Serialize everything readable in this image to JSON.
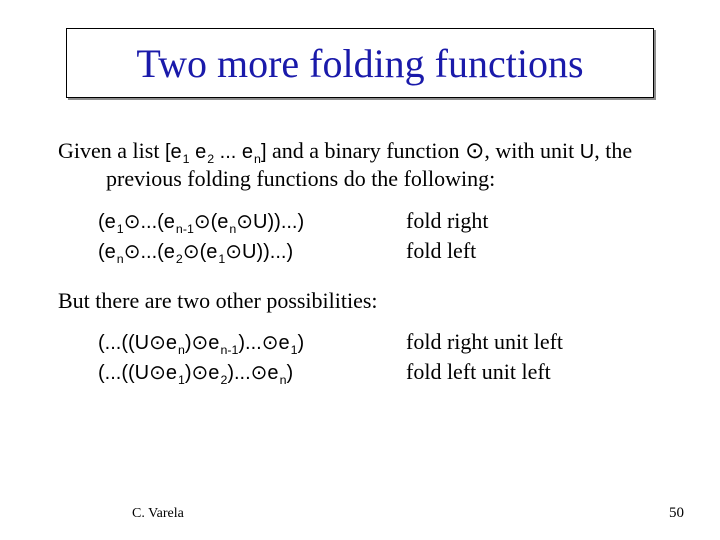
{
  "title": "Two more folding functions",
  "intro": {
    "prefix": "Given a list ",
    "list_open": "[e",
    "s1": "1",
    "sp1": " e",
    "s2": "2",
    "dots": " ... e",
    "sn": "n",
    "list_close": "]",
    "mid": " and a binary function ",
    "op": "⊙",
    "after_op": ", with unit ",
    "unit": "U",
    "suffix": ", the previous folding functions do the following:"
  },
  "rows1": [
    {
      "lhs_a": "(e",
      "lhs_a_sub": "1",
      "lhs_b": "⊙...(e",
      "lhs_b_sub": "n-1",
      "lhs_c": "⊙(e",
      "lhs_c_sub": "n",
      "lhs_d": "⊙U))...)",
      "rhs": "fold right"
    },
    {
      "lhs_a": "(e",
      "lhs_a_sub": "n",
      "lhs_b": "⊙...(e",
      "lhs_b_sub": "2",
      "lhs_c": "⊙(e",
      "lhs_c_sub": "1",
      "lhs_d": "⊙U))...)",
      "rhs": "fold left"
    }
  ],
  "mid_para": "But there are two other possibilities:",
  "rows2": [
    {
      "lhs_a": "(...((U⊙e",
      "lhs_a_sub": "n",
      "lhs_b": ")⊙e",
      "lhs_b_sub": "n-1",
      "lhs_c": ")...⊙e",
      "lhs_c_sub": "1",
      "lhs_d": ")",
      "rhs": "fold right unit left"
    },
    {
      "lhs_a": "(...((U⊙e",
      "lhs_a_sub": "1",
      "lhs_b": ")⊙e",
      "lhs_b_sub": "2",
      "lhs_c": ")...⊙e",
      "lhs_c_sub": "n",
      "lhs_d": ")",
      "rhs": "fold left unit left"
    }
  ],
  "footer": {
    "author": "C. Varela",
    "page": "50"
  }
}
